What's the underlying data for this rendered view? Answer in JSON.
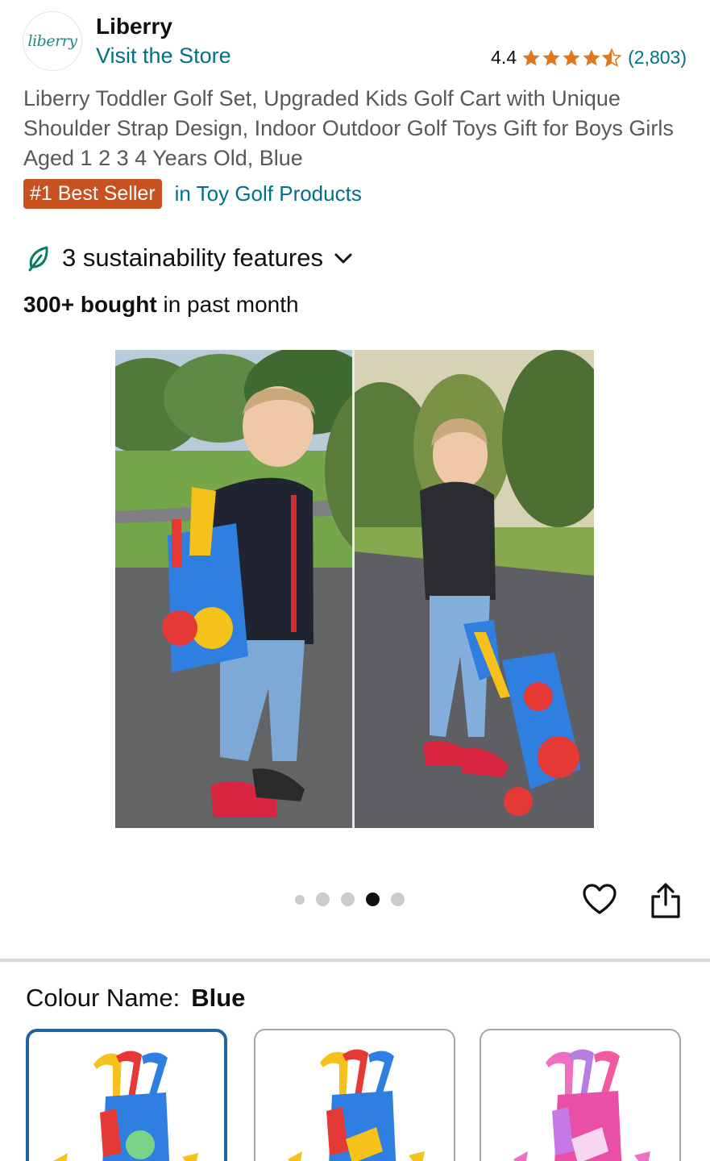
{
  "brand": {
    "logo_text": "liberry",
    "name": "Liberry",
    "visit_store": "Visit the Store"
  },
  "rating": {
    "value": "4.4",
    "stars_out_of_5": 4.4,
    "count": "(2,803)",
    "star_color": "#de7921"
  },
  "product": {
    "title": "Liberry Toddler Golf Set, Upgraded Kids Golf Cart with Unique Shoulder Strap Design, Indoor Outdoor Golf Toys Gift for Boys Girls Aged 1 2 3 4 Years Old, Blue"
  },
  "badge": {
    "label": "#1 Best Seller",
    "category": "in Toy Golf Products",
    "color": "#c7511f"
  },
  "sustainability": {
    "label": "3 sustainability features",
    "icon": "leaf-icon"
  },
  "bought": {
    "bold": "300+ bought",
    "rest": " in past month"
  },
  "gallery": {
    "image_count": 5,
    "active_index": 3
  },
  "colour": {
    "label": "Colour Name:",
    "selected": "Blue",
    "options": [
      {
        "name": "Blue",
        "selected": true
      },
      {
        "name": "Blue Golf",
        "selected": false
      },
      {
        "name": "Pink",
        "selected": false
      }
    ]
  },
  "colors": {
    "link": "#007185",
    "selected_border": "#2162a1"
  }
}
